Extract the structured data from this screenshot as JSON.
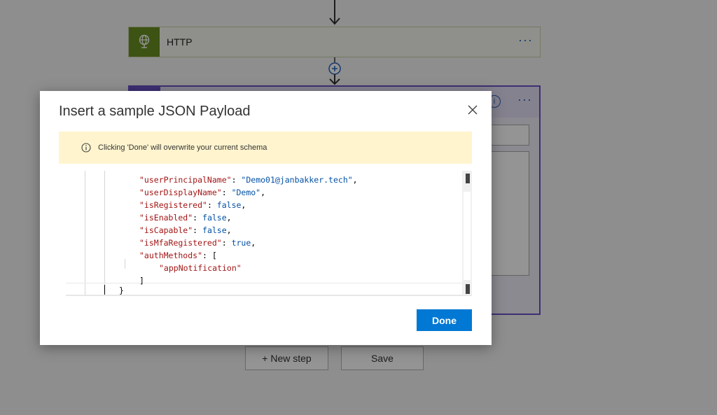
{
  "background": {
    "http_action": {
      "title": "HTTP",
      "menu": "···"
    },
    "parse_action": {
      "menu": "···",
      "info": "i"
    },
    "new_step_label": "+ New step",
    "save_label": "Save"
  },
  "modal": {
    "title": "Insert a sample JSON Payload",
    "warning": "Clicking 'Done' will overwrite your current schema",
    "done_label": "Done",
    "code": [
      {
        "key": "\"userPrincipalName\"",
        "sep": ": ",
        "value": "\"Demo01@janbakker.tech\"",
        "value_type": "string",
        "end": ","
      },
      {
        "key": "\"userDisplayName\"",
        "sep": ": ",
        "value": "\"Demo\"",
        "value_type": "string",
        "end": ","
      },
      {
        "key": "\"isRegistered\"",
        "sep": ": ",
        "value": "false",
        "value_type": "literal",
        "end": ","
      },
      {
        "key": "\"isEnabled\"",
        "sep": ": ",
        "value": "false",
        "value_type": "literal",
        "end": ","
      },
      {
        "key": "\"isCapable\"",
        "sep": ": ",
        "value": "false",
        "value_type": "literal",
        "end": ","
      },
      {
        "key": "\"isMfaRegistered\"",
        "sep": ": ",
        "value": "true",
        "value_type": "literal",
        "end": ","
      },
      {
        "key": "\"authMethods\"",
        "sep": ": ",
        "value": "[",
        "value_type": "punct",
        "end": ""
      },
      {
        "key": "",
        "sep": "",
        "value": "\"appNotification\"",
        "value_type": "key",
        "end": ""
      },
      {
        "key": "",
        "sep": "",
        "value": "]",
        "value_type": "punct",
        "end": ""
      },
      {
        "key": "",
        "sep": "",
        "value": "}",
        "value_type": "punct",
        "end": ""
      }
    ]
  },
  "colors": {
    "accent": "#0078d4",
    "http_green": "#6a8f24",
    "parse_purple": "#6b52c8",
    "warning_bg": "#fff4ce",
    "json_key": "#a31515",
    "json_value": "#0451a5"
  },
  "icons": {
    "http": "globe-icon",
    "close": "close-icon",
    "warning": "info-icon",
    "add": "add-step-icon"
  }
}
